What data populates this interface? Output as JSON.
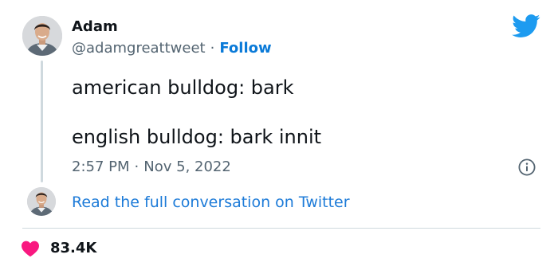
{
  "tweet": {
    "author_name": "Adam",
    "author_handle": "@adamgreattweet",
    "separator": "·",
    "follow_label": "Follow",
    "lines": [
      "american bulldog: bark",
      "english bulldog: bark innit"
    ],
    "time": "2:57 PM",
    "date": "Nov 5, 2022",
    "read_link": "Read the full conversation on Twitter",
    "likes": "83.4K"
  },
  "colors": {
    "link": "#1d7bd8",
    "twitter_blue": "#1d9bf0",
    "heart": "#f91880",
    "muted": "#536471"
  },
  "icons": {
    "brand": "twitter-bird-icon",
    "info": "info-icon",
    "like": "heart-icon"
  }
}
